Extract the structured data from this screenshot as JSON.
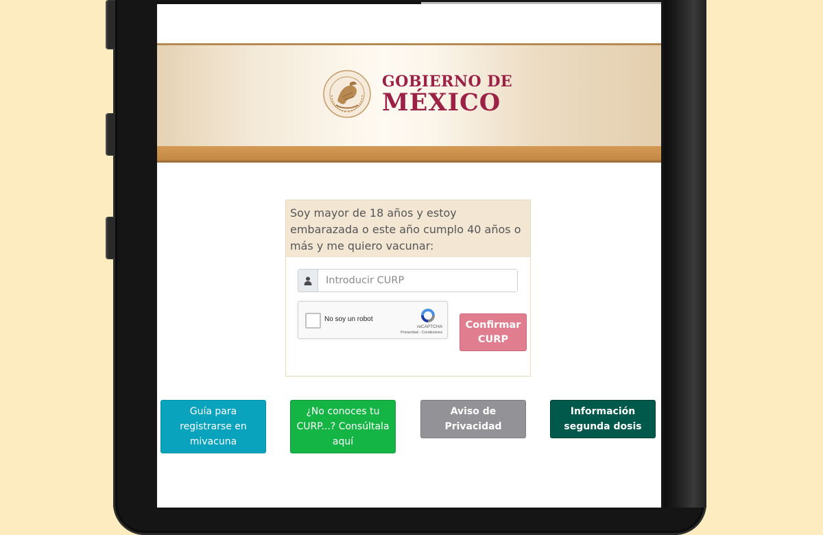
{
  "header": {
    "gov_line1": "GOBIERNO DE",
    "gov_line2": "MÉXICO",
    "seal_text": "ESTADOS UNIDOS MEXICANOS"
  },
  "form": {
    "intro": "Soy mayor de 18 años y estoy embarazada o este año cumplo 40 años o más y me quiero vacunar:",
    "curp_placeholder": "Introducir CURP",
    "curp_value": "",
    "recaptcha_label": "No soy un robot",
    "recaptcha_brand": "reCAPTCHA",
    "recaptcha_links": "Privacidad - Condiciones",
    "confirm_label": "Confirmar CURP"
  },
  "actions": {
    "guide_label": "Guía para registrarse en mivacuna",
    "curp_lookup_label": "¿No conoces tu CURP...? Consúltala aquí",
    "privacy_label": "Aviso de Privacidad",
    "second_dose_label": "Información segunda dosis"
  },
  "colors": {
    "gov_red": "#9b2246",
    "confirm": "#e07d8e",
    "guide": "#0aa3be",
    "curp_lookup": "#14b445",
    "privacy": "#939296",
    "second_dose": "#00594a"
  },
  "icons": {
    "curp_addon": "user-icon",
    "seal": "national-seal-icon",
    "recaptcha": "recaptcha-logo-icon"
  }
}
